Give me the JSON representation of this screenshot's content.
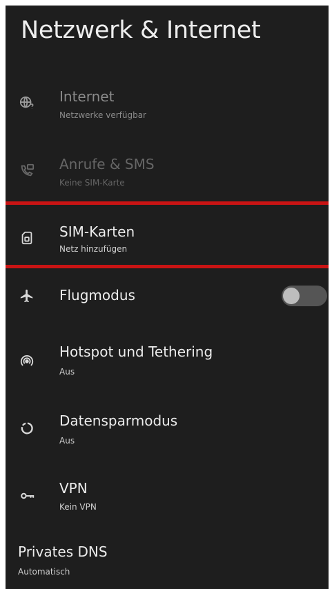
{
  "page": {
    "title": "Netzwerk & Internet"
  },
  "items": [
    {
      "icon": "globe-question-icon",
      "title": "Internet",
      "subtitle": "Netzwerke verfügbar",
      "enabled": true
    },
    {
      "icon": "phone-message-icon",
      "title": "Anrufe & SMS",
      "subtitle": "Keine SIM-Karte",
      "enabled": false
    },
    {
      "icon": "sim-card-icon",
      "title": "SIM-Karten",
      "subtitle": "Netz hinzufügen",
      "enabled": true,
      "highlighted": true
    },
    {
      "icon": "airplane-icon",
      "title": "Flugmodus",
      "toggle": false
    },
    {
      "icon": "hotspot-icon",
      "title": "Hotspot und Tethering",
      "subtitle": "Aus"
    },
    {
      "icon": "data-saver-icon",
      "title": "Datensparmodus",
      "subtitle": "Aus"
    },
    {
      "icon": "vpn-key-icon",
      "title": "VPN",
      "subtitle": "Kein VPN"
    },
    {
      "title": "Privates DNS",
      "subtitle": "Automatisch"
    }
  ],
  "colors": {
    "background": "#1e1e1e",
    "highlight": "#c91414",
    "text": "#ececec",
    "disabled_text": "#666666"
  }
}
